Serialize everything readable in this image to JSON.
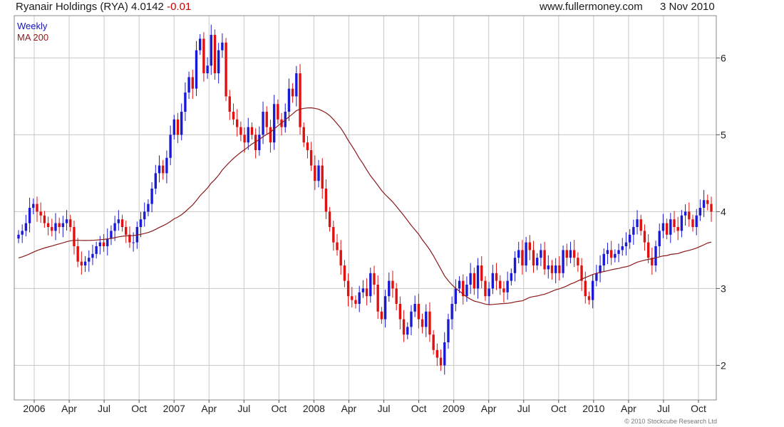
{
  "header": {
    "security": "Ryanair Holdings (RYA)",
    "price": "4.0142",
    "change": "-0.01",
    "website": "www.fullermoney.com",
    "date": "3 Nov 2010"
  },
  "legend": {
    "weekly": "Weekly",
    "ma": "MA 200"
  },
  "copyright": "© 2010 Stockcube Research Ltd",
  "colors": {
    "up": "#1a1ad6",
    "down": "#e01010",
    "ma": "#8b1a1a",
    "grid": "#c8c8c8"
  },
  "chart_data": {
    "type": "candlestick",
    "y_ticks": [
      2,
      3,
      4,
      5,
      6
    ],
    "ylim": [
      1.55,
      6.55
    ],
    "grid": true,
    "x_tick_labels": [
      "2006",
      "Apr",
      "Jul",
      "Oct",
      "2007",
      "Apr",
      "Jul",
      "Oct",
      "2008",
      "Apr",
      "Jul",
      "Oct",
      "2009",
      "Apr",
      "Jul",
      "Oct",
      "2010",
      "Apr",
      "Jul",
      "Oct"
    ],
    "weekly_close": [
      3.7,
      3.75,
      3.85,
      4.05,
      4.1,
      4.0,
      3.95,
      3.85,
      3.8,
      3.75,
      3.85,
      3.8,
      3.85,
      3.9,
      3.8,
      3.55,
      3.35,
      3.3,
      3.35,
      3.4,
      3.45,
      3.55,
      3.6,
      3.55,
      3.65,
      3.75,
      3.85,
      3.9,
      3.8,
      3.7,
      3.6,
      3.6,
      3.8,
      3.9,
      4.0,
      4.1,
      4.3,
      4.5,
      4.6,
      4.5,
      4.7,
      5.0,
      5.2,
      5.0,
      5.3,
      5.55,
      5.75,
      5.6,
      6.1,
      6.25,
      5.8,
      5.9,
      6.3,
      5.8,
      6.1,
      6.2,
      5.5,
      5.3,
      5.2,
      5.1,
      5.0,
      4.9,
      5.1,
      5.0,
      4.8,
      5.0,
      5.3,
      5.1,
      4.9,
      5.4,
      5.2,
      5.1,
      5.3,
      5.6,
      5.5,
      5.8,
      5.1,
      4.9,
      4.8,
      4.6,
      4.4,
      4.6,
      4.3,
      4.0,
      3.8,
      3.6,
      3.5,
      3.3,
      3.1,
      2.9,
      2.85,
      2.8,
      2.95,
      3.0,
      2.9,
      3.2,
      3.05,
      2.7,
      2.6,
      2.9,
      3.1,
      3.0,
      2.8,
      2.6,
      2.4,
      2.5,
      2.7,
      2.8,
      2.6,
      2.5,
      2.7,
      2.4,
      2.2,
      2.1,
      2.0,
      2.3,
      2.6,
      2.8,
      3.0,
      3.1,
      2.9,
      3.05,
      3.2,
      3.0,
      3.3,
      3.1,
      2.9,
      3.0,
      3.2,
      3.1,
      3.0,
      2.95,
      3.1,
      3.2,
      3.4,
      3.5,
      3.3,
      3.6,
      3.5,
      3.3,
      3.4,
      3.5,
      3.25,
      3.3,
      3.2,
      3.3,
      3.2,
      3.5,
      3.4,
      3.5,
      3.4,
      3.3,
      3.1,
      2.9,
      2.85,
      3.1,
      3.2,
      3.3,
      3.45,
      3.5,
      3.4,
      3.45,
      3.5,
      3.55,
      3.6,
      3.7,
      3.8,
      3.9,
      3.75,
      3.6,
      3.4,
      3.3,
      3.55,
      3.75,
      3.85,
      3.7,
      3.9,
      3.8,
      3.75,
      3.95,
      4.0,
      3.9,
      3.8,
      3.95,
      4.05,
      4.15,
      4.1,
      4.0
    ]
  }
}
